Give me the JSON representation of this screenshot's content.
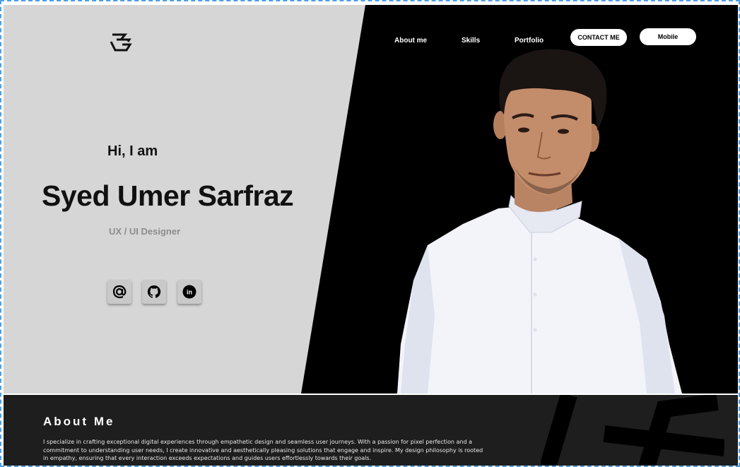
{
  "nav": {
    "links": [
      "About me",
      "Skills",
      "Portfolio"
    ],
    "contact_label": "CONTACT ME",
    "mobile_label": "Mobile"
  },
  "hero": {
    "greeting": "Hi, I am",
    "name": "Syed Umer Sarfraz",
    "role": "UX / UI Designer"
  },
  "social": [
    {
      "icon": "at-icon"
    },
    {
      "icon": "github-icon"
    },
    {
      "icon": "linkedin-icon",
      "glyph": "in"
    }
  ],
  "about": {
    "title": "About Me",
    "text": "I specialize in crafting exceptional digital experiences through empathetic design and seamless user journeys. With a passion for pixel perfection and a commitment to understanding user needs, I create innovative and aesthetically pleasing solutions that engage and inspire. My design philosophy is rooted in empathy, ensuring that every interaction exceeds expectations and guides users effortlessly towards their goals."
  },
  "colors": {
    "left_panel": "#d6d6d6",
    "right_panel": "#000000",
    "about_bg": "#1e1e1e",
    "shirt": "#f2f4fa",
    "accent_border": "#4a9fe8"
  }
}
